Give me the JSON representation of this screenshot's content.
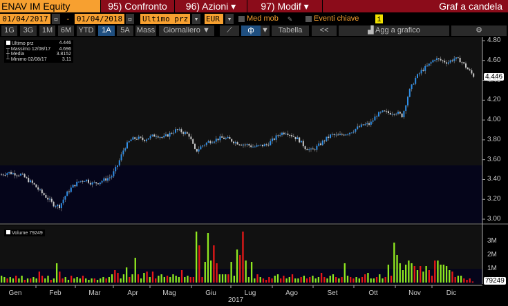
{
  "header": {
    "ticker": "ENAV IM Equity",
    "btn95": "95) Confronto",
    "btn96": "96) Azioni",
    "btn97": "97) Modif",
    "title": "Graf a candela"
  },
  "controls": {
    "start_date": "01/04/2017",
    "dash": "-",
    "end_date": "01/04/2018",
    "field": "Ultimo prz",
    "currency": "EUR",
    "moving_avg": "Med mob",
    "key_events": "Eventi chiave",
    "info": "i"
  },
  "periods": [
    "1G",
    "3G",
    "1M",
    "6M",
    "YTD",
    "1A",
    "5A",
    "Mass"
  ],
  "selected_period": "1A",
  "frequency": "Giornaliero ▼",
  "toolbar": {
    "table": "Tabella",
    "back": "<<",
    "add_to_chart": "Agg a grafico",
    "dropdown": "▼"
  },
  "legend": {
    "last_label": "Ultimo prz",
    "last_value": "4.446",
    "high_label": "Massimo 12/08/17",
    "high_value": "4.696",
    "mean_label": "Media",
    "mean_value": "3.8152",
    "low_label": "Minimo 02/08/17",
    "low_value": "3.11"
  },
  "volume_legend": "Volume 79249",
  "colors": {
    "up": "#2f8fe8",
    "down": "#c8c8c8",
    "vol_up": "#8fe820",
    "vol_down": "#e81818",
    "orange": "#f7a030",
    "darkred": "#8b0c1a"
  },
  "chart_data": {
    "type": "candlestick",
    "title": "Graf a candela",
    "ylim": [
      3.0,
      4.8
    ],
    "yticks": [
      "4.80",
      "4.60",
      "4.40",
      "4.20",
      "4.00",
      "3.80",
      "3.60",
      "3.40",
      "3.20",
      "3.00"
    ],
    "last_price_label": "4.446",
    "months": [
      "Gen",
      "Feb",
      "Mar",
      "Apr",
      "Mag",
      "Giu",
      "Lug",
      "Ago",
      "Set",
      "Ott",
      "Nov",
      "Dic"
    ],
    "year": "2017",
    "weekly_closes": [
      3.45,
      3.47,
      3.46,
      3.45,
      3.4,
      3.35,
      3.28,
      3.22,
      3.15,
      3.13,
      3.25,
      3.33,
      3.38,
      3.4,
      3.36,
      3.37,
      3.4,
      3.43,
      3.55,
      3.72,
      3.8,
      3.82,
      3.8,
      3.83,
      3.85,
      3.82,
      3.86,
      3.9,
      3.88,
      3.85,
      3.68,
      3.74,
      3.78,
      3.8,
      3.82,
      3.81,
      3.78,
      3.76,
      3.75,
      3.73,
      3.74,
      3.75,
      3.8,
      3.86,
      3.88,
      3.84,
      3.8,
      3.72,
      3.69,
      3.74,
      3.8,
      3.85,
      3.84,
      3.86,
      3.88,
      3.92,
      3.95,
      3.96,
      4.05,
      4.08,
      4.07,
      4.08,
      4.04,
      4.28,
      4.42,
      4.5,
      4.55,
      4.62,
      4.6,
      4.58,
      4.62,
      4.6,
      4.52,
      4.446
    ],
    "volume": {
      "name": "Volume",
      "last": "79249",
      "yticks": [
        "3M",
        "2M",
        "1M"
      ],
      "ylim_millions": [
        0,
        3.8
      ],
      "values_millions": [
        0.5,
        0.4,
        0.3,
        0.4,
        0.3,
        0.5,
        0.3,
        0.5,
        0.2,
        0.3,
        0.3,
        0.4,
        0.3,
        0.8,
        0.5,
        0.3,
        0.5,
        0.2,
        0.3,
        1.4,
        0.8,
        0.3,
        0.4,
        0.2,
        0.5,
        0.3,
        0.4,
        0.3,
        0.5,
        0.3,
        0.2,
        0.3,
        0.3,
        0.2,
        0.3,
        0.4,
        0.3,
        0.4,
        0.6,
        0.9,
        0.7,
        0.3,
        0.6,
        1.1,
        0.4,
        0.6,
        1.8,
        0.6,
        0.3,
        0.7,
        0.8,
        0.4,
        0.8,
        0.3,
        0.5,
        0.6,
        0.4,
        0.5,
        0.4,
        0.6,
        0.5,
        0.4,
        0.9,
        0.4,
        0.5,
        0.4,
        0.4,
        3.7,
        2.7,
        0.4,
        1.5,
        3.6,
        1.6,
        2.7,
        1.4,
        0.6,
        0.6,
        0.6,
        0.6,
        1.5,
        0.5,
        2.4,
        2.0,
        3.7,
        1.6,
        0.4,
        1.5,
        0.3,
        0.6,
        0.4,
        0.3,
        0.2,
        0.4,
        0.3,
        0.5,
        0.6,
        0.3,
        0.5,
        0.3,
        0.4,
        0.6,
        0.3,
        0.3,
        0.4,
        0.5,
        0.3,
        0.4,
        0.5,
        0.3,
        0.4,
        0.7,
        0.4,
        0.3,
        0.5,
        0.6,
        0.4,
        0.3,
        0.4,
        1.4,
        0.5,
        0.4,
        0.3,
        0.4,
        0.3,
        0.4,
        0.6,
        0.7,
        0.3,
        0.3,
        0.4,
        0.6,
        0.3,
        0.4,
        1.3,
        0.5,
        2.9,
        2.0,
        1.4,
        0.9,
        1.3,
        1.6,
        1.4,
        1.2,
        0.9,
        1.2,
        0.8,
        1.2,
        0.9,
        0.5,
        1.6,
        1.6,
        1.3,
        1.3,
        1.2,
        0.9,
        0.8,
        0.4,
        0.5,
        0.5,
        0.3,
        0.2,
        0.3,
        0.08
      ],
      "up_flags": [
        1,
        1,
        0,
        1,
        1,
        0,
        1,
        1,
        0,
        1,
        0,
        1,
        1,
        0,
        0,
        1,
        1,
        0,
        1,
        1,
        0,
        0,
        1,
        1,
        0,
        1,
        1,
        1,
        0,
        1,
        1,
        1,
        0,
        1,
        1,
        1,
        0,
        1,
        1,
        0,
        0,
        1,
        1,
        1,
        0,
        1,
        1,
        0,
        1,
        1,
        0,
        1,
        0,
        0,
        1,
        1,
        1,
        0,
        1,
        1,
        1,
        1,
        0,
        1,
        1,
        0,
        0,
        1,
        0,
        0,
        1,
        1,
        1,
        0,
        0,
        1,
        1,
        1,
        0,
        1,
        1,
        1,
        0,
        0,
        1,
        1,
        1,
        1,
        0,
        1,
        0,
        0,
        0,
        0,
        1,
        1,
        0,
        0,
        1,
        1,
        0,
        1,
        1,
        0,
        1,
        0,
        0,
        1,
        1,
        1,
        0,
        0,
        1,
        1,
        1,
        0,
        1,
        0,
        1,
        1,
        0,
        0,
        1,
        1,
        0,
        0,
        1,
        1,
        1,
        0,
        1,
        1,
        0,
        1,
        0,
        1,
        1,
        1,
        1,
        1,
        1,
        1,
        0,
        1,
        0,
        1,
        1,
        0,
        0,
        0,
        1,
        1,
        1,
        1,
        1,
        0,
        0,
        1,
        1,
        0,
        0
      ]
    }
  }
}
